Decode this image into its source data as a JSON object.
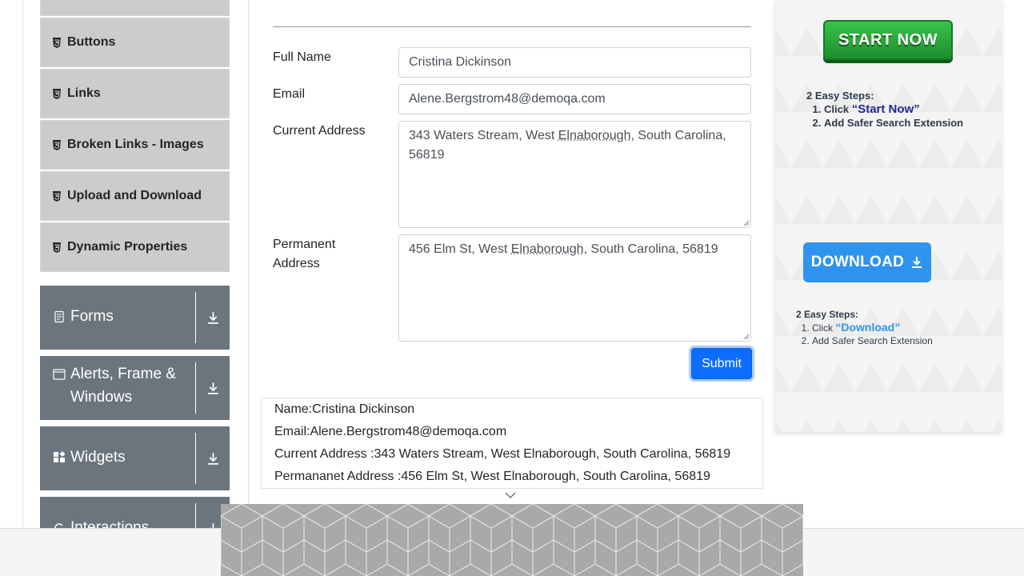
{
  "sidebar": {
    "items": [
      {
        "label": "Buttons",
        "icon": "html5-icon"
      },
      {
        "label": "Links",
        "icon": "html5-icon"
      },
      {
        "label": "Broken Links - Images",
        "icon": "html5-icon"
      },
      {
        "label": "Upload and Download",
        "icon": "html5-icon"
      },
      {
        "label": "Dynamic Properties",
        "icon": "html5-icon"
      }
    ],
    "groups": [
      {
        "label": "Forms",
        "icon": "document-icon"
      },
      {
        "label": "Alerts, Frame & Windows",
        "icon": "window-icon"
      },
      {
        "label": "Widgets",
        "icon": "widgets-icon"
      },
      {
        "label": "Interactions",
        "icon": "interactions-icon"
      }
    ]
  },
  "form": {
    "full_name_label": "Full Name",
    "full_name_value": "Cristina Dickinson",
    "email_label": "Email",
    "email_value": "Alene.Bergstrom48@demoqa.com",
    "current_address_label": "Current Address",
    "current_address_pre": "343 Waters Stream, West ",
    "current_address_u": "Elnaborough",
    "current_address_post": ", South Carolina, 56819",
    "permanent_address_label": "Permanent Address",
    "permanent_address_pre": "456 Elm St, West ",
    "permanent_address_u": "Elnaborough",
    "permanent_address_post": ", South Carolina, 56819",
    "submit_label": "Submit"
  },
  "output": {
    "name": "Name:Cristina Dickinson",
    "email": "Email:Alene.Bergstrom48@demoqa.com",
    "current_address": "Current Address :343 Waters Stream, West Elnaborough, South Carolina, 56819",
    "permanent_address": "Permananet Address :456 Elm St, West Elnaborough, South Carolina, 56819"
  },
  "ad_right": {
    "start_label": "START NOW",
    "steps_title": "2 Easy Steps:",
    "step1_pre": "Click ",
    "step1_highlight": "“Start Now”",
    "step2": "Add Safer Search Extension",
    "download_label": "DOWNLOAD",
    "steps2_title": "2 Easy Steps:",
    "step2_1_pre": "Click ",
    "step2_1_highlight": "“Download”",
    "step2_2": "Add Safer Search Extension"
  },
  "colors": {
    "primary": "#0d6efd",
    "sidebar_group": "#6c757d",
    "sidebar_item": "#cccccc",
    "ad_green": "#2eaa3e",
    "ad_blue": "#2f94ee"
  }
}
